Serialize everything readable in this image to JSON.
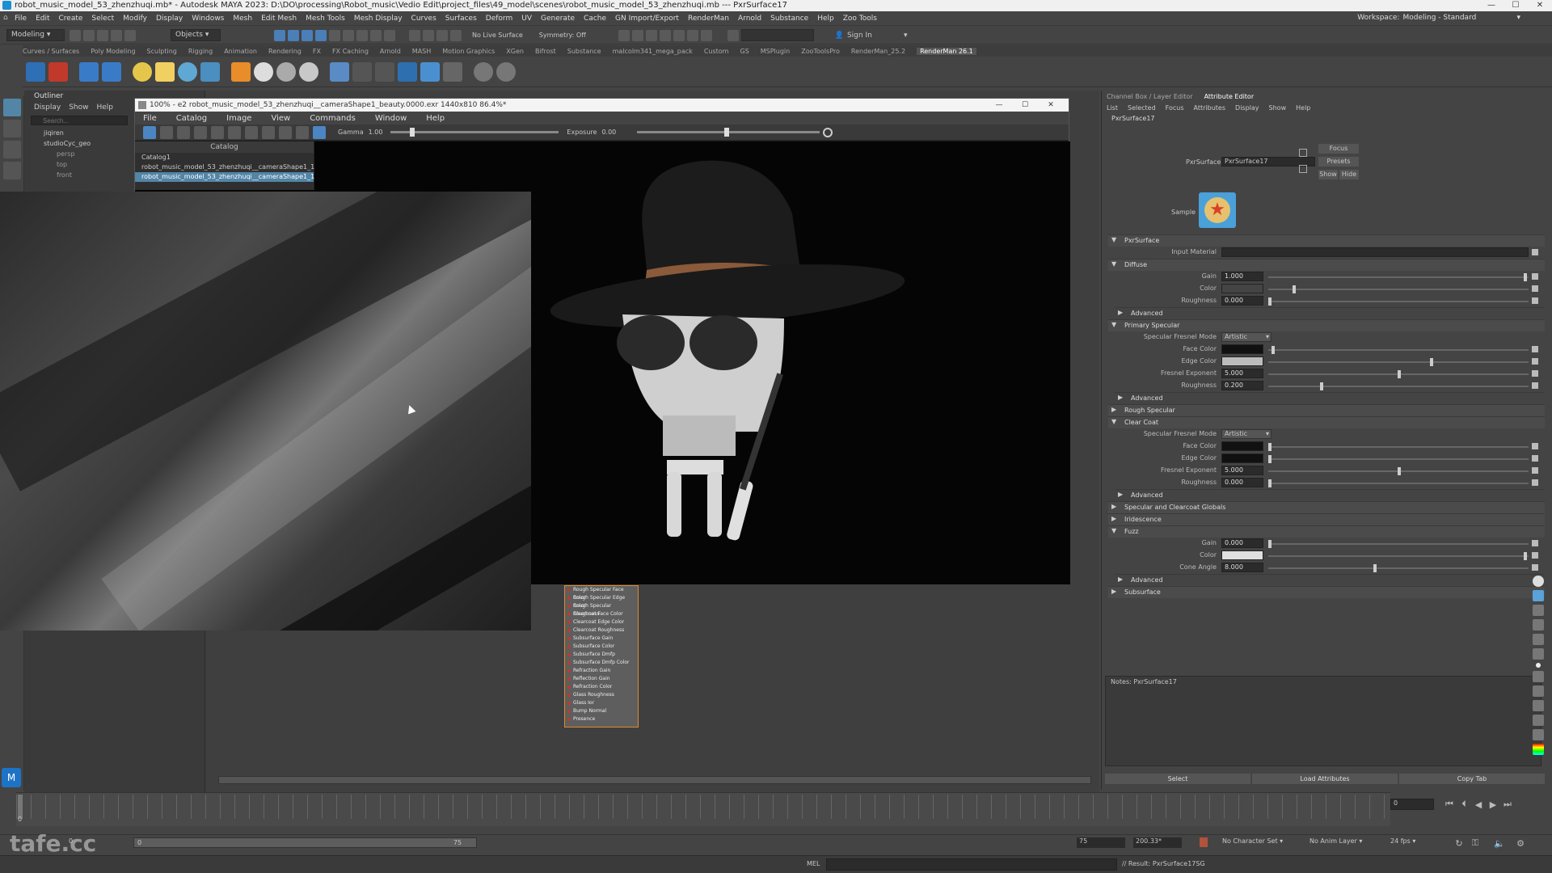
{
  "app": {
    "title": "robot_music_model_53_zhenzhuqi.mb* - Autodesk MAYA 2023: D:\\DO\\processing\\Robot_music\\Vedio Edit\\project_files\\49_model\\scenes\\robot_music_model_53_zhenzhuqi.mb  ---  PxrSurface17",
    "workspace_label": "Workspace:",
    "workspace_value": "Modeling - Standard"
  },
  "menubar": [
    "File",
    "Edit",
    "Create",
    "Select",
    "Modify",
    "Display",
    "Windows",
    "Mesh",
    "Edit Mesh",
    "Mesh Tools",
    "Mesh Display",
    "Curves",
    "Surfaces",
    "Deform",
    "UV",
    "Generate",
    "Cache",
    "GN Import/Export",
    "RenderMan",
    "Arnold",
    "Substance",
    "Help",
    "Zoo Tools"
  ],
  "statusline": {
    "mode": "Modeling",
    "objects": "Objects",
    "live_surface": "No Live Surface",
    "symmetry": "Symmetry: Off",
    "signin": "Sign In"
  },
  "shelf_tabs": [
    "Curves / Surfaces",
    "Poly Modeling",
    "Sculpting",
    "Rigging",
    "Animation",
    "Rendering",
    "FX",
    "FX Caching",
    "Arnold",
    "MASH",
    "Motion Graphics",
    "XGen",
    "Bifrost",
    "Substance",
    "malcolm341_mega_pack",
    "Custom",
    "GS",
    "MSPlugin",
    "ZooToolsPro",
    "RenderMan_25.2",
    "RenderMan 26.1"
  ],
  "shelf_active": "RenderMan 26.1",
  "outliner": {
    "title": "Outliner",
    "menu": [
      "Display",
      "Show",
      "Help"
    ],
    "search_placeholder": "Search...",
    "items": [
      "jiqiren",
      "studioCyc_geo"
    ],
    "sub_items": [
      "persp",
      "top",
      "front"
    ]
  },
  "render_window": {
    "title": "100% - e2 robot_music_model_53_zhenzhuqi__cameraShape1_beauty.0000.exr  1440x810  86.4%*",
    "menu": [
      "File",
      "Catalog",
      "Image",
      "View",
      "Commands",
      "Window",
      "Help"
    ],
    "gamma_label": "Gamma",
    "gamma_value": "1.00",
    "exposure_label": "Exposure",
    "exposure_value": "0.00",
    "catalog_title": "Catalog",
    "catalog_items": [
      "Catalog1",
      "robot_music_model_53_zhenzhuqi__cameraShape1_1",
      "robot_music_model_53_zhenzhuqi__cameraShape1_1"
    ]
  },
  "node_list": [
    "Rough Specular Face Color",
    "Rough Specular Edge Color",
    "Rough Specular Roughness",
    "Clearcoat Face Color",
    "Clearcoat Edge Color",
    "Clearcoat Roughness",
    "Subsurface Gain",
    "Subsurface Color",
    "Subsurface Dmfp",
    "Subsurface Dmfp Color",
    "Refraction Gain",
    "Reflection Gain",
    "Refraction Color",
    "Glass Roughness",
    "Glass Ior",
    "Bump Normal",
    "Presence"
  ],
  "attribute_editor": {
    "tabs": [
      "Channel Box / Layer Editor",
      "Attribute Editor"
    ],
    "menu": [
      "List",
      "Selected",
      "Focus",
      "Attributes",
      "Display",
      "Show",
      "Help"
    ],
    "node_name": "PxrSurface17",
    "shader_label": "PxrSurface:",
    "shader_value": "PxrSurface17",
    "focus_btn": "Focus",
    "presets_btn": "Presets",
    "show_btn": "Show",
    "hide_btn": "Hide",
    "sample_label": "Sample",
    "sections": {
      "pxrsurface": "PxrSurface",
      "input_material": "Input Material",
      "diffuse": "Diffuse",
      "advanced": "Advanced",
      "primary_specular": "Primary Specular",
      "rough_specular": "Rough Specular",
      "clear_coat": "Clear Coat",
      "spec_globals": "Specular and Clearcoat Globals",
      "iridescence": "Iridescence",
      "fuzz": "Fuzz",
      "subsurface": "Subsurface"
    },
    "labels": {
      "gain": "Gain",
      "color": "Color",
      "roughness": "Roughness",
      "fresnel_mode": "Specular Fresnel Mode",
      "face_color": "Face Color",
      "edge_color": "Edge Color",
      "fresnel_exp": "Fresnel Exponent",
      "cone_angle": "Cone Angle"
    },
    "values": {
      "diffuse_gain": "1.000",
      "diffuse_roughness": "0.000",
      "primary_mode": "Artistic",
      "primary_fresnel": "5.000",
      "primary_roughness": "0.200",
      "cc_mode": "Artistic",
      "cc_fresnel": "5.000",
      "cc_roughness": "0.000",
      "fuzz_gain": "0.000",
      "fuzz_cone": "8.000"
    },
    "notes_label": "Notes:  PxrSurface17",
    "bottom_buttons": [
      "Select",
      "Load Attributes",
      "Copy Tab"
    ]
  },
  "timeline": {
    "current_frame": "0",
    "range_start": "0",
    "range_inner": "0",
    "range_end": "75",
    "range_end2": "75",
    "range_value": "200.33*",
    "character_set": "No Character Set",
    "anim_layer": "No Anim Layer",
    "fps": "24 fps"
  },
  "cmdline": {
    "label": "MEL",
    "result": "// Result: PxrSurface17SG"
  },
  "watermark": "tafe.cc",
  "colors": {
    "accent": "#5285a6",
    "sample_star": "#e04a2a",
    "sample_bg": "#4aa0d8"
  }
}
